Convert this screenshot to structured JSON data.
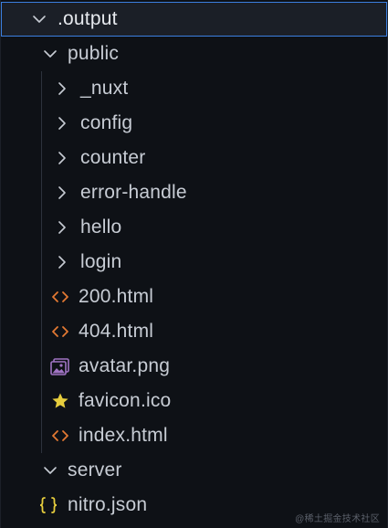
{
  "explorer": {
    "items": [
      {
        "label": ".output",
        "icon": "chevron-down-icon",
        "kind": "folder-open"
      },
      {
        "label": "public",
        "icon": "chevron-down-icon",
        "kind": "folder-open"
      },
      {
        "label": "_nuxt",
        "icon": "chevron-right-icon",
        "kind": "folder-closed"
      },
      {
        "label": "config",
        "icon": "chevron-right-icon",
        "kind": "folder-closed"
      },
      {
        "label": "counter",
        "icon": "chevron-right-icon",
        "kind": "folder-closed"
      },
      {
        "label": "error-handle",
        "icon": "chevron-right-icon",
        "kind": "folder-closed"
      },
      {
        "label": "hello",
        "icon": "chevron-right-icon",
        "kind": "folder-closed"
      },
      {
        "label": "login",
        "icon": "chevron-right-icon",
        "kind": "folder-closed"
      },
      {
        "label": "200.html",
        "icon": "html-file-icon",
        "kind": "file"
      },
      {
        "label": "404.html",
        "icon": "html-file-icon",
        "kind": "file"
      },
      {
        "label": "avatar.png",
        "icon": "image-file-icon",
        "kind": "file"
      },
      {
        "label": "favicon.ico",
        "icon": "star-file-icon",
        "kind": "file"
      },
      {
        "label": "index.html",
        "icon": "html-file-icon",
        "kind": "file"
      },
      {
        "label": "server",
        "icon": "chevron-down-icon",
        "kind": "folder-open"
      },
      {
        "label": "nitro.json",
        "icon": "json-file-icon",
        "kind": "file"
      }
    ]
  },
  "watermark": "@稀土掘金技术社区",
  "colors": {
    "background": "#0e1116",
    "text": "#c7ccd4",
    "selection_border": "#3b7fe0",
    "html_icon": "#e37933",
    "image_icon": "#a074c4",
    "star_icon": "#e6cd3d",
    "json_icon": "#e6cd3d"
  }
}
